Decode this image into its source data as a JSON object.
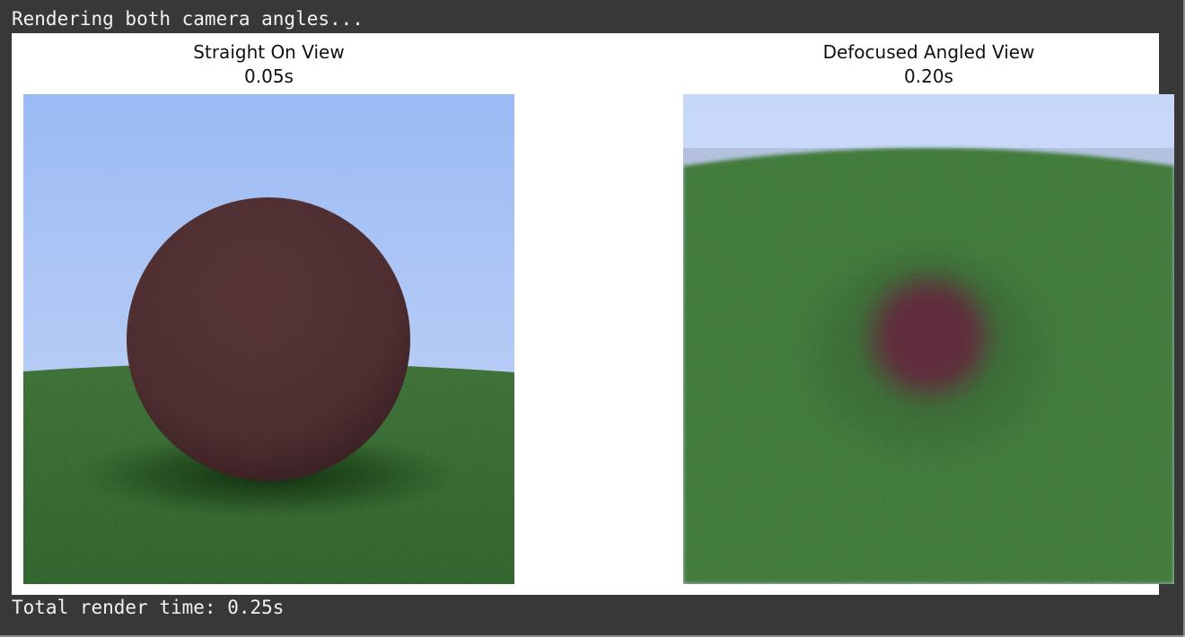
{
  "output": {
    "header_line": "Rendering both camera angles...",
    "footer_line": "Total render time: 0.25s"
  },
  "figure": {
    "panels": [
      {
        "title": "Straight On View",
        "subtitle": "0.05s",
        "scene": "sphere-on-ground-straight",
        "sky_color": "#9dbcf5",
        "ground_color": "#3f7f3a",
        "sphere_color": "#5a3538"
      },
      {
        "title": "Defocused Angled View",
        "subtitle": "0.20s",
        "scene": "sphere-on-ground-defocused",
        "sky_color": "#c8d8f8",
        "ground_color": "#4a8a44",
        "sphere_color": "#6a3442"
      }
    ]
  }
}
